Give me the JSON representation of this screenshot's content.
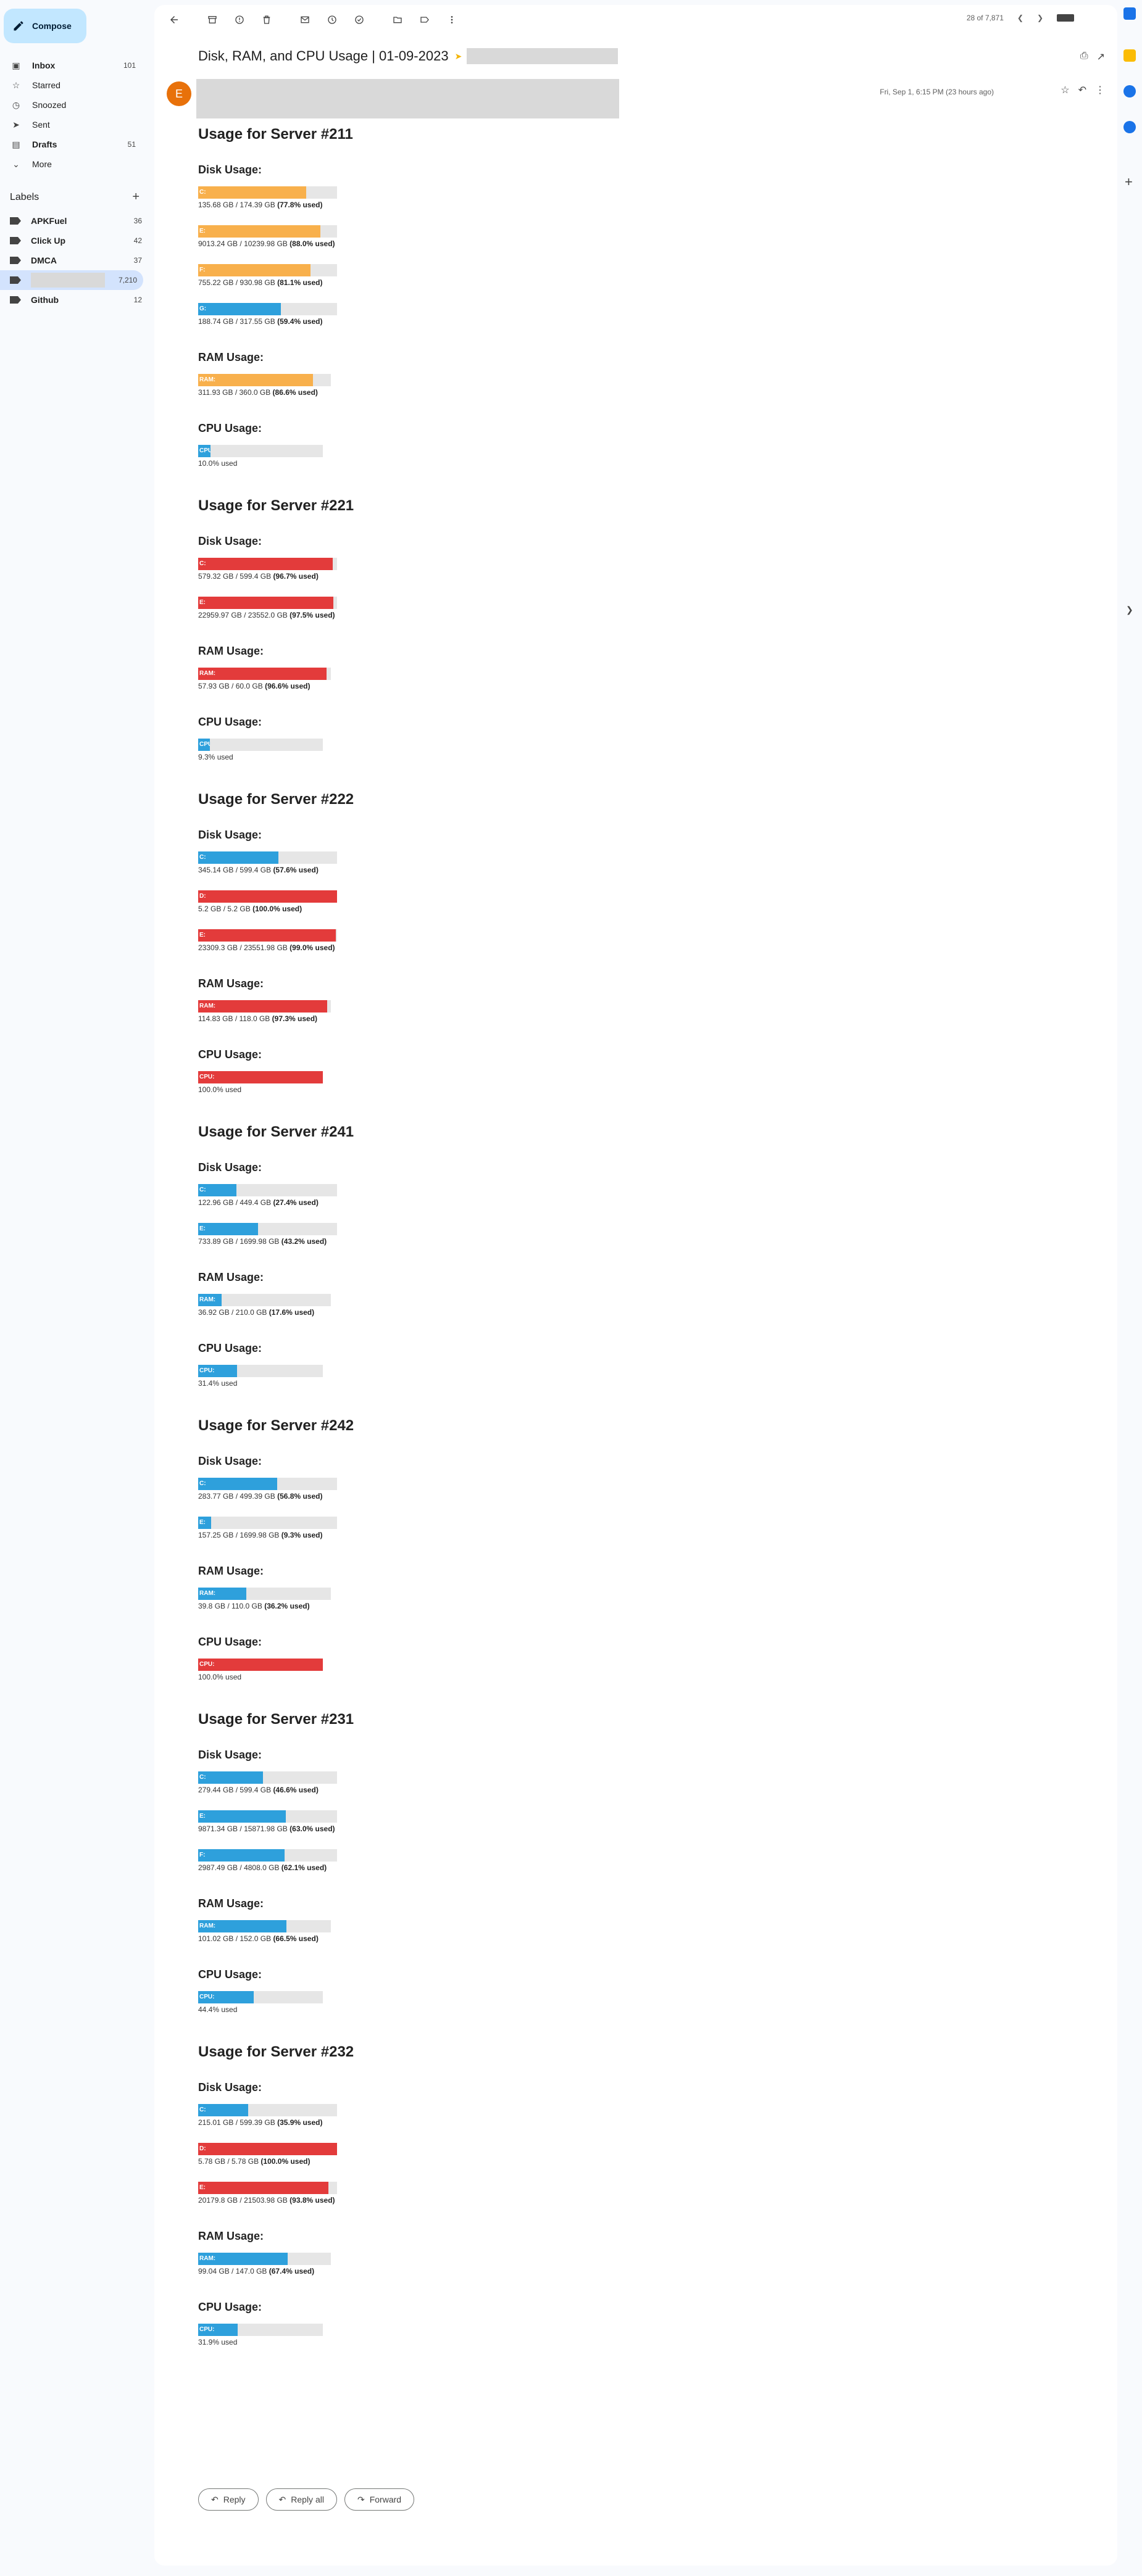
{
  "sidebar": {
    "compose_label": "Compose",
    "nav": [
      {
        "label": "Inbox",
        "count": "101",
        "icon": "inbox-icon",
        "bold": true
      },
      {
        "label": "Starred",
        "count": "",
        "icon": "star-icon",
        "bold": false
      },
      {
        "label": "Snoozed",
        "count": "",
        "icon": "clock-icon",
        "bold": false
      },
      {
        "label": "Sent",
        "count": "",
        "icon": "send-icon",
        "bold": false
      },
      {
        "label": "Drafts",
        "count": "51",
        "icon": "draft-icon",
        "bold": true
      },
      {
        "label": "More",
        "count": "",
        "icon": "chevron-down-icon",
        "bold": false
      }
    ],
    "labels_title": "Labels",
    "labels": [
      {
        "label": "APKFuel",
        "count": "36"
      },
      {
        "label": "Click Up",
        "count": "42"
      },
      {
        "label": "DMCA",
        "count": "37"
      },
      {
        "label": "",
        "count": "7,210",
        "redacted": true,
        "active": true
      },
      {
        "label": "Github",
        "count": "12"
      }
    ]
  },
  "toolbar": {
    "pager": "28 of 7,871"
  },
  "email": {
    "subject": "Disk, RAM, and CPU Usage | 01-09-2023",
    "sender_initial": "E",
    "date": "Fri, Sep 1, 6:15 PM (23 hours ago)",
    "used_suffix": "used"
  },
  "servers": [
    {
      "title": "Usage for Server #211",
      "disk_heading": "Disk Usage:",
      "ram_heading": "RAM Usage:",
      "cpu_heading": "CPU Usage:",
      "disks": [
        {
          "label": "C:",
          "used": "135.68 GB",
          "total": "174.39 GB",
          "pct": 77.8,
          "color": "#f8b04c"
        },
        {
          "label": "E:",
          "used": "9013.24 GB",
          "total": "10239.98 GB",
          "pct": 88.0,
          "color": "#f8b04c"
        },
        {
          "label": "F:",
          "used": "755.22 GB",
          "total": "930.98 GB",
          "pct": 81.1,
          "color": "#f8b04c"
        },
        {
          "label": "G:",
          "used": "188.74 GB",
          "total": "317.55 GB",
          "pct": 59.4,
          "color": "#2ea0dc"
        }
      ],
      "ram": {
        "label": "RAM:",
        "used": "311.93 GB",
        "total": "360.0 GB",
        "pct": 86.6,
        "color": "#f8b04c"
      },
      "cpu": {
        "label": "CPU:",
        "pct": 10.0,
        "color": "#2ea0dc"
      }
    },
    {
      "title": "Usage for Server #221",
      "disk_heading": "Disk Usage:",
      "ram_heading": "RAM Usage:",
      "cpu_heading": "CPU Usage:",
      "disks": [
        {
          "label": "C:",
          "used": "579.32 GB",
          "total": "599.4 GB",
          "pct": 96.7,
          "color": "#e33b3b"
        },
        {
          "label": "E:",
          "used": "22959.97 GB",
          "total": "23552.0 GB",
          "pct": 97.5,
          "color": "#e33b3b"
        }
      ],
      "ram": {
        "label": "RAM:",
        "used": "57.93 GB",
        "total": "60.0 GB",
        "pct": 96.6,
        "color": "#e33b3b"
      },
      "cpu": {
        "label": "CPU:",
        "pct": 9.3,
        "color": "#2ea0dc"
      }
    },
    {
      "title": "Usage for Server #222",
      "disk_heading": "Disk Usage:",
      "ram_heading": "RAM Usage:",
      "cpu_heading": "CPU Usage:",
      "disks": [
        {
          "label": "C:",
          "used": "345.14 GB",
          "total": "599.4 GB",
          "pct": 57.6,
          "color": "#2ea0dc"
        },
        {
          "label": "D:",
          "used": "5.2 GB",
          "total": "5.2 GB",
          "pct": 100.0,
          "color": "#e33b3b"
        },
        {
          "label": "E:",
          "used": "23309.3 GB",
          "total": "23551.98 GB",
          "pct": 99.0,
          "color": "#e33b3b"
        }
      ],
      "ram": {
        "label": "RAM:",
        "used": "114.83 GB",
        "total": "118.0 GB",
        "pct": 97.3,
        "color": "#e33b3b"
      },
      "cpu": {
        "label": "CPU:",
        "pct": 100.0,
        "color": "#e33b3b"
      }
    },
    {
      "title": "Usage for Server #241",
      "disk_heading": "Disk Usage:",
      "ram_heading": "RAM Usage:",
      "cpu_heading": "CPU Usage:",
      "disks": [
        {
          "label": "C:",
          "used": "122.96 GB",
          "total": "449.4 GB",
          "pct": 27.4,
          "color": "#2ea0dc"
        },
        {
          "label": "E:",
          "used": "733.89 GB",
          "total": "1699.98 GB",
          "pct": 43.2,
          "color": "#2ea0dc"
        }
      ],
      "ram": {
        "label": "RAM:",
        "used": "36.92 GB",
        "total": "210.0 GB",
        "pct": 17.6,
        "color": "#2ea0dc"
      },
      "cpu": {
        "label": "CPU:",
        "pct": 31.4,
        "color": "#2ea0dc"
      }
    },
    {
      "title": "Usage for Server #242",
      "disk_heading": "Disk Usage:",
      "ram_heading": "RAM Usage:",
      "cpu_heading": "CPU Usage:",
      "disks": [
        {
          "label": "C:",
          "used": "283.77 GB",
          "total": "499.39 GB",
          "pct": 56.8,
          "color": "#2ea0dc"
        },
        {
          "label": "E:",
          "used": "157.25 GB",
          "total": "1699.98 GB",
          "pct": 9.3,
          "color": "#2ea0dc"
        }
      ],
      "ram": {
        "label": "RAM:",
        "used": "39.8 GB",
        "total": "110.0 GB",
        "pct": 36.2,
        "color": "#2ea0dc"
      },
      "cpu": {
        "label": "CPU:",
        "pct": 100.0,
        "color": "#e33b3b"
      }
    },
    {
      "title": "Usage for Server #231",
      "disk_heading": "Disk Usage:",
      "ram_heading": "RAM Usage:",
      "cpu_heading": "CPU Usage:",
      "disks": [
        {
          "label": "C:",
          "used": "279.44 GB",
          "total": "599.4 GB",
          "pct": 46.6,
          "color": "#2ea0dc"
        },
        {
          "label": "E:",
          "used": "9871.34 GB",
          "total": "15871.98 GB",
          "pct": 63.0,
          "color": "#2ea0dc"
        },
        {
          "label": "F:",
          "used": "2987.49 GB",
          "total": "4808.0 GB",
          "pct": 62.1,
          "color": "#2ea0dc"
        }
      ],
      "ram": {
        "label": "RAM:",
        "used": "101.02 GB",
        "total": "152.0 GB",
        "pct": 66.5,
        "color": "#2ea0dc"
      },
      "cpu": {
        "label": "CPU:",
        "pct": 44.4,
        "color": "#2ea0dc"
      }
    },
    {
      "title": "Usage for Server #232",
      "disk_heading": "Disk Usage:",
      "ram_heading": "RAM Usage:",
      "cpu_heading": "CPU Usage:",
      "disks": [
        {
          "label": "C:",
          "used": "215.01 GB",
          "total": "599.39 GB",
          "pct": 35.9,
          "color": "#2ea0dc"
        },
        {
          "label": "D:",
          "used": "5.78 GB",
          "total": "5.78 GB",
          "pct": 100.0,
          "color": "#e33b3b"
        },
        {
          "label": "E:",
          "used": "20179.8 GB",
          "total": "21503.98 GB",
          "pct": 93.8,
          "color": "#e33b3b"
        }
      ],
      "ram": {
        "label": "RAM:",
        "used": "99.04 GB",
        "total": "147.0 GB",
        "pct": 67.4,
        "color": "#2ea0dc"
      },
      "cpu": {
        "label": "CPU:",
        "pct": 31.9,
        "color": "#2ea0dc"
      }
    }
  ],
  "replies": {
    "reply": "Reply",
    "reply_all": "Reply all",
    "forward": "Forward"
  }
}
